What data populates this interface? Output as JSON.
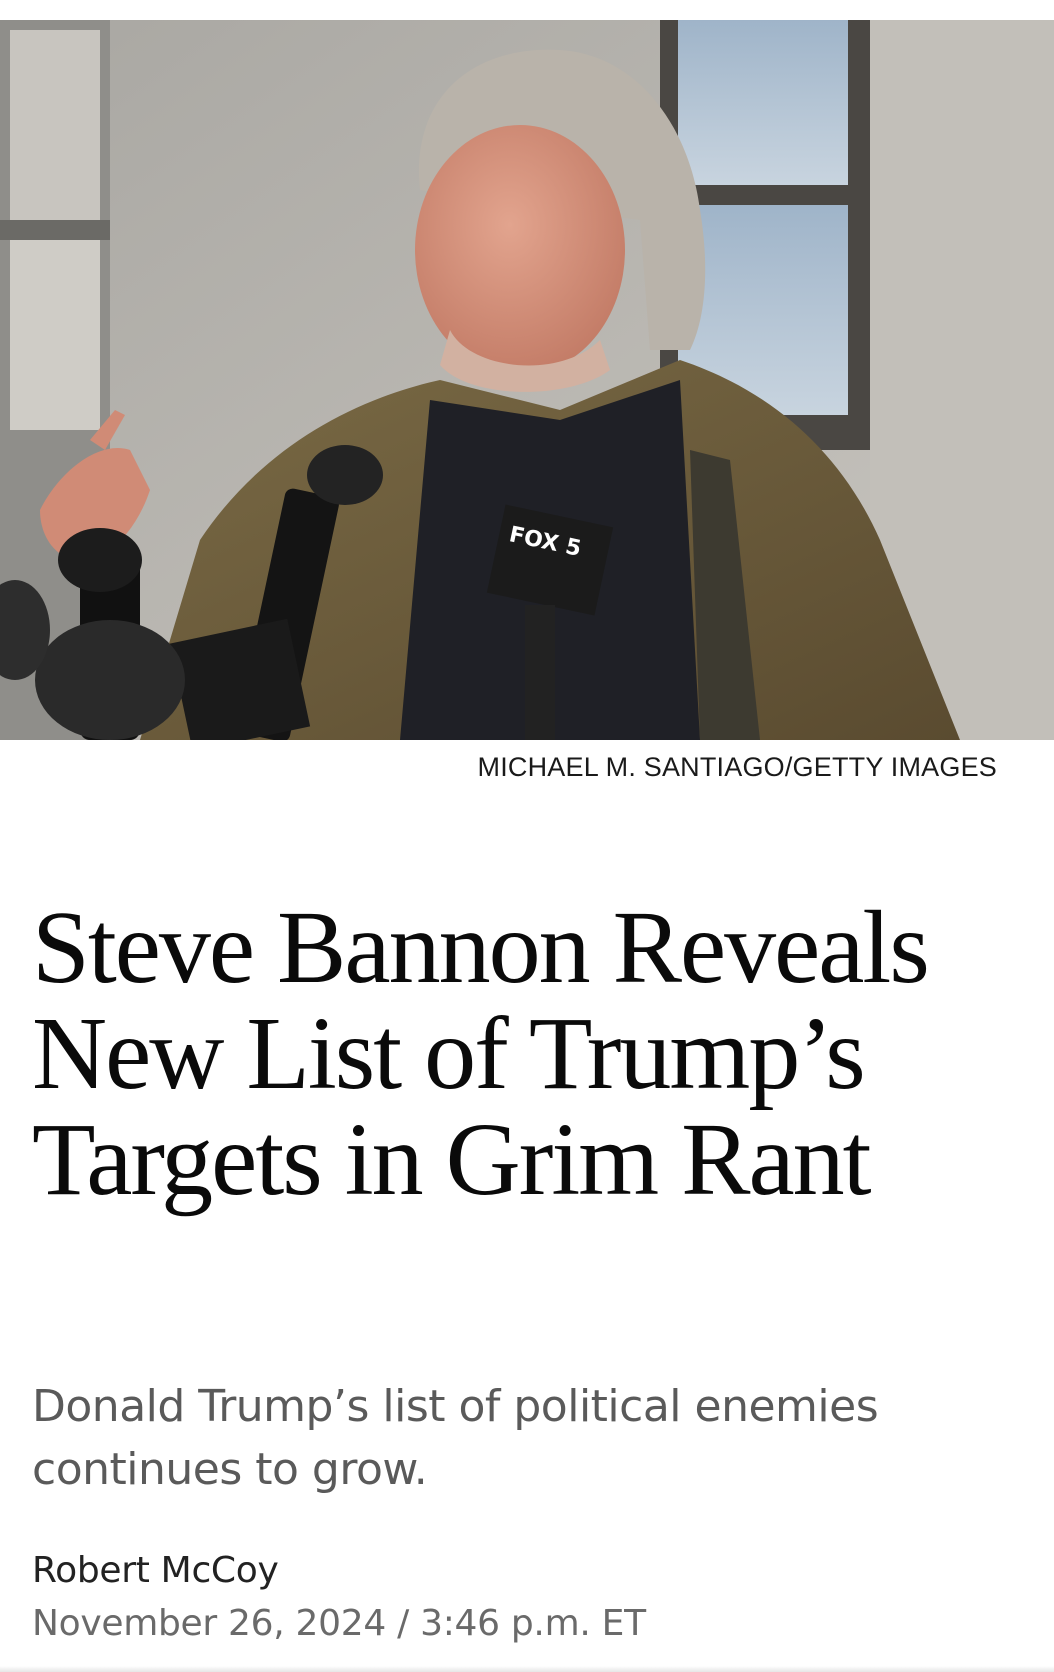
{
  "hero_image": {
    "alt": "Man with long gray hair in olive jacket speaking into microphones outside a building",
    "mic_flag_text": "FOX 5"
  },
  "photo_credit": "MICHAEL M. SANTIAGO/GETTY IMAGES",
  "article": {
    "headline": "Steve Bannon Reveals New List of Trump’s Targets in Grim Rant",
    "dek": "Donald Trump’s list of political enemies continues to grow.",
    "author": "Robert McCoy",
    "date": "November 26, 2024",
    "separator": "/",
    "time": "3:46 p.m. ET"
  },
  "colors": {
    "headline": "#0a0a0a",
    "dek": "#5a5a5a",
    "date": "#6a6a6a"
  }
}
